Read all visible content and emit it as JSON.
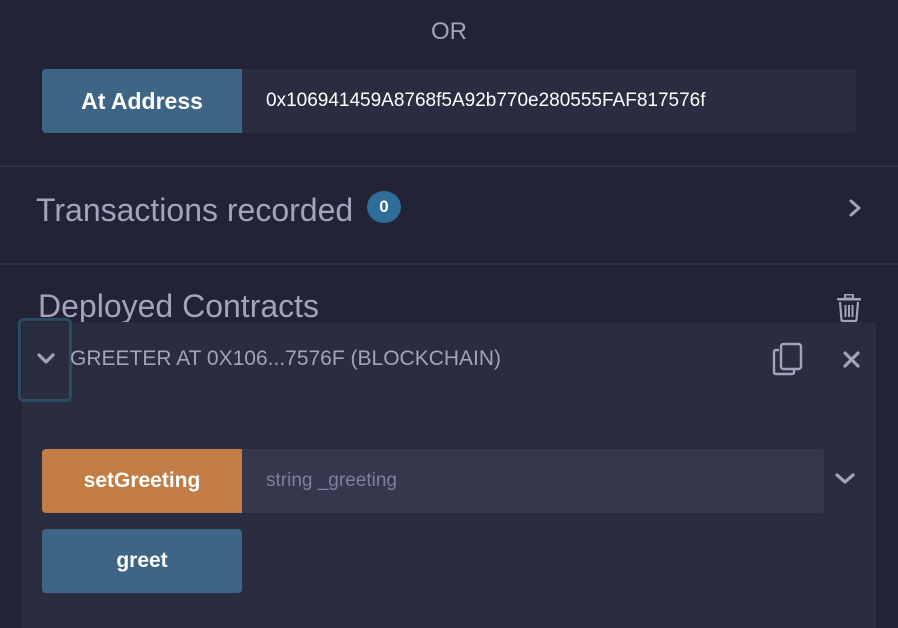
{
  "or_label": "OR",
  "at_address": {
    "button_label": "At Address",
    "input_value": "0x106941459A8768f5A92b770e280555FAF817576f"
  },
  "transactions": {
    "title": "Transactions recorded",
    "count": "0"
  },
  "deployed": {
    "title": "Deployed Contracts",
    "contract_name": "GREETER AT 0X106...7576F (BLOCKCHAIN)",
    "functions": {
      "set_greeting": {
        "label": "setGreeting",
        "placeholder": "string _greeting"
      },
      "greet": {
        "label": "greet"
      }
    }
  },
  "colors": {
    "background": "#222336",
    "panel": "#2a2c3f",
    "blue_button": "#3e6585",
    "orange_button": "#c27d46",
    "badge": "#2f6d9a"
  },
  "icons": {
    "tx_expand": "chevron-right-icon",
    "trash": "trash-icon",
    "contract_toggle": "chevron-down-icon",
    "copy": "copy-icon",
    "close": "close-icon",
    "fn_expand": "chevron-down-icon"
  }
}
